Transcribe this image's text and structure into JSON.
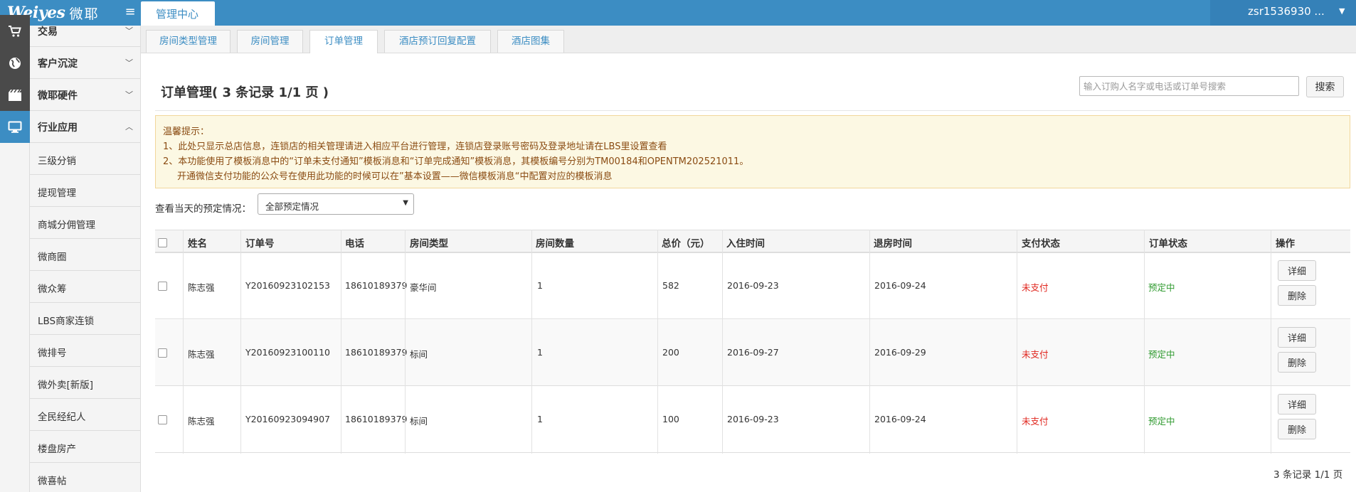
{
  "header": {
    "logo_latin": "Weiyes",
    "logo_cn": "微耶",
    "menu_icon": "hamburger-icon",
    "top_tab": "管理中心",
    "user": "zsr1536930 ...",
    "user_caret": "▼"
  },
  "sidebar": {
    "items": [
      {
        "label": "交易",
        "icon": "cart-icon",
        "chevron": "﹀"
      },
      {
        "label": "客户沉淀",
        "icon": "globe-icon",
        "chevron": "﹀"
      },
      {
        "label": "微耶硬件",
        "icon": "film-icon",
        "chevron": "﹀"
      },
      {
        "label": "行业应用",
        "icon": "monitor-icon",
        "chevron": "︿"
      }
    ],
    "sub_items": [
      "三级分销",
      "提现管理",
      "商城分佣管理",
      "微商圈",
      "微众筹",
      "LBS商家连锁",
      "微排号",
      "微外卖[新版]",
      "全民经纪人",
      "楼盘房产",
      "微喜帖"
    ]
  },
  "tabs": [
    "房间类型管理",
    "房间管理",
    "订单管理",
    "酒店预订回复配置",
    "酒店图集"
  ],
  "page": {
    "title": "订单管理( 3 条记录 1/1 页 )",
    "search_placeholder": "输入订购人名字或电话或订单号搜索",
    "search_button": "搜索"
  },
  "notice": {
    "heading": "温馨提示：",
    "line1": "1、此处只显示总店信息，连锁店的相关管理请进入相应平台进行管理，连锁店登录账号密码及登录地址请在LBS里设置查看",
    "line2": "2、本功能使用了模板消息中的“订单未支付通知”模板消息和“订单完成通知”模板消息，其模板编号分别为TM00184和OPENTM202521011。",
    "line3": "开通微信支付功能的公众号在使用此功能的时候可以在”基本设置——微信模板消息“中配置对应的模板消息"
  },
  "filter": {
    "label": "查看当天的预定情况：",
    "selected": "全部预定情况",
    "caret": "▼"
  },
  "table": {
    "headers": [
      "姓名",
      "订单号",
      "电话",
      "房间类型",
      "房间数量",
      "总价（元）",
      "入住时间",
      "退房时间",
      "支付状态",
      "订单状态",
      "操作"
    ],
    "rows": [
      {
        "name": "陈志强",
        "order_no": "Y20160923102153",
        "phone": "18610189379",
        "room_type": "豪华间",
        "count": "1",
        "total": "582",
        "checkin": "2016-09-23",
        "checkout": "2016-09-24",
        "pay_status": "未支付",
        "order_status": "预定中"
      },
      {
        "name": "陈志强",
        "order_no": "Y20160923100110",
        "phone": "18610189379",
        "room_type": "标间",
        "count": "1",
        "total": "200",
        "checkin": "2016-09-27",
        "checkout": "2016-09-29",
        "pay_status": "未支付",
        "order_status": "预定中"
      },
      {
        "name": "陈志强",
        "order_no": "Y20160923094907",
        "phone": "18610189379",
        "room_type": "标间",
        "count": "1",
        "total": "100",
        "checkin": "2016-09-23",
        "checkout": "2016-09-24",
        "pay_status": "未支付",
        "order_status": "预定中"
      }
    ],
    "detail_label": "详细",
    "delete_label": "删除"
  },
  "pager": "3 条记录 1/1 页",
  "colors": {
    "brand": "#3c8dc3",
    "unpaid": "#e0261e",
    "pending": "#2f9a2f",
    "notice_text": "#8a4b12"
  }
}
